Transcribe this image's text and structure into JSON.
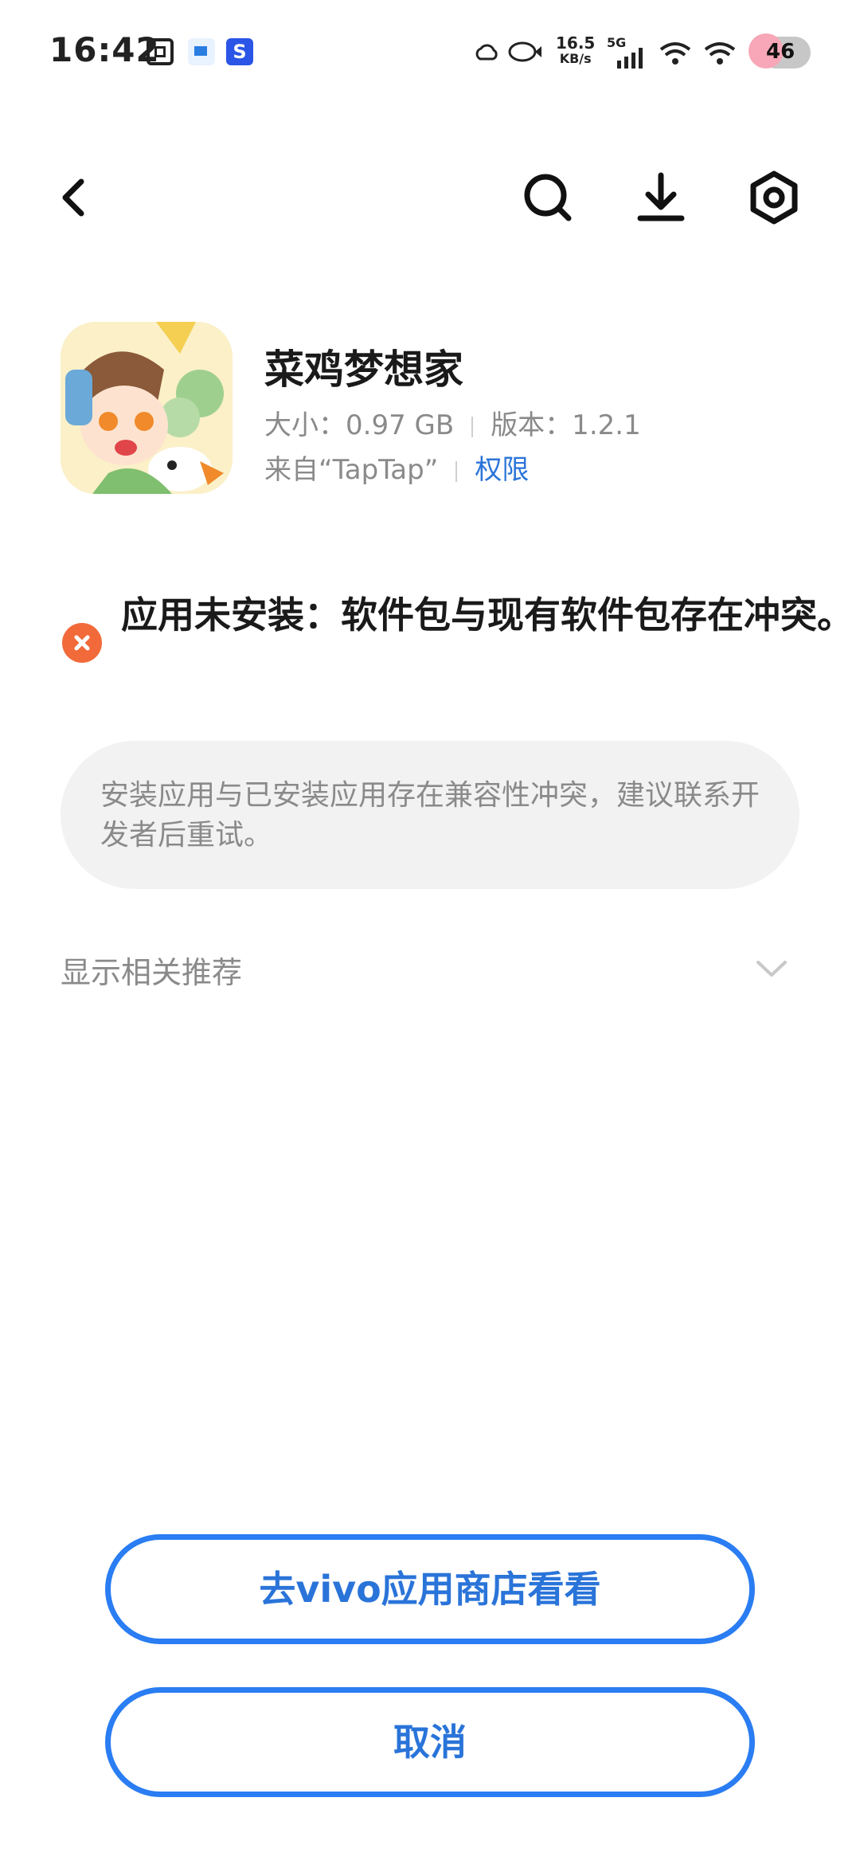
{
  "status_bar": {
    "time": "16:42",
    "speed_value": "16.5",
    "speed_unit": "KB/s",
    "network": "5G",
    "battery": "46"
  },
  "toolbar": {
    "back_icon": "back-arrow-icon",
    "search_icon": "search-icon",
    "download_icon": "download-icon",
    "settings_icon": "settings-icon"
  },
  "app": {
    "name": "菜鸡梦想家",
    "size": "大小：0.97 GB",
    "version": "版本：1.2.1",
    "source": "来自“TapTap”",
    "permissions": "权限"
  },
  "error": {
    "message": "应用未安装：软件包与现有软件包存在冲突。",
    "icon": "error-close-icon",
    "color": "#f26a3a"
  },
  "info": {
    "text": "安装应用与已安装应用存在兼容性冲突，建议联系开发者后重试。"
  },
  "related": {
    "label": "显示相关推荐"
  },
  "buttons": {
    "store": "去vivo应用商店看看",
    "cancel": "取消",
    "accent": "#2a7df2"
  }
}
